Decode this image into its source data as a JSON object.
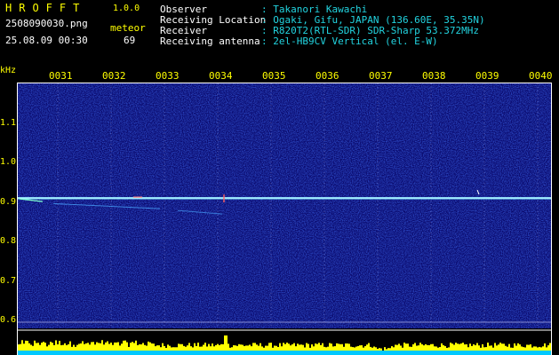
{
  "app": {
    "brand": "HROFFT",
    "version": "1.0.0",
    "filename": "2508090030.png",
    "timestamp": "25.08.09 00:30",
    "meteor_label": "meteor",
    "meteor_count": "69"
  },
  "info": [
    {
      "label": "Observer",
      "value": ": Takanori Kawachi"
    },
    {
      "label": "Receiving Location",
      "value": ": Ogaki, Gifu, JAPAN (136.60E, 35.35N)"
    },
    {
      "label": "Receiver",
      "value": ": R820T2(RTL-SDR) SDR-Sharp 53.372MHz"
    },
    {
      "label": "Receiving antenna",
      "value": ": 2el-HB9CV Vertical (el. E-W)"
    }
  ],
  "chart_data": {
    "type": "heatmap",
    "ylabel": "kHz",
    "time_ticks": [
      "0031",
      "0032",
      "0033",
      "0034",
      "0035",
      "0036",
      "0037",
      "0038",
      "0039",
      "0040"
    ],
    "freq_ticks": [
      "1.1",
      "1.0",
      "0.9",
      "0.8",
      "0.7",
      "0.6"
    ],
    "freq_values": [
      1.1,
      1.0,
      0.9,
      0.8,
      0.7,
      0.6
    ],
    "ylim": [
      0.58,
      1.2
    ],
    "carrier_khz": 0.91,
    "faint_trace_khz": [
      0.896,
      0.874
    ]
  },
  "colors": {
    "background": "#000000",
    "label": "#ffff00",
    "info_value": "#22d4e0",
    "spectrogram_bg": "#0a0a6e",
    "carrier": "#7fe6ff",
    "level_bar": "#ffff00",
    "level_base": "#00c8ff"
  }
}
